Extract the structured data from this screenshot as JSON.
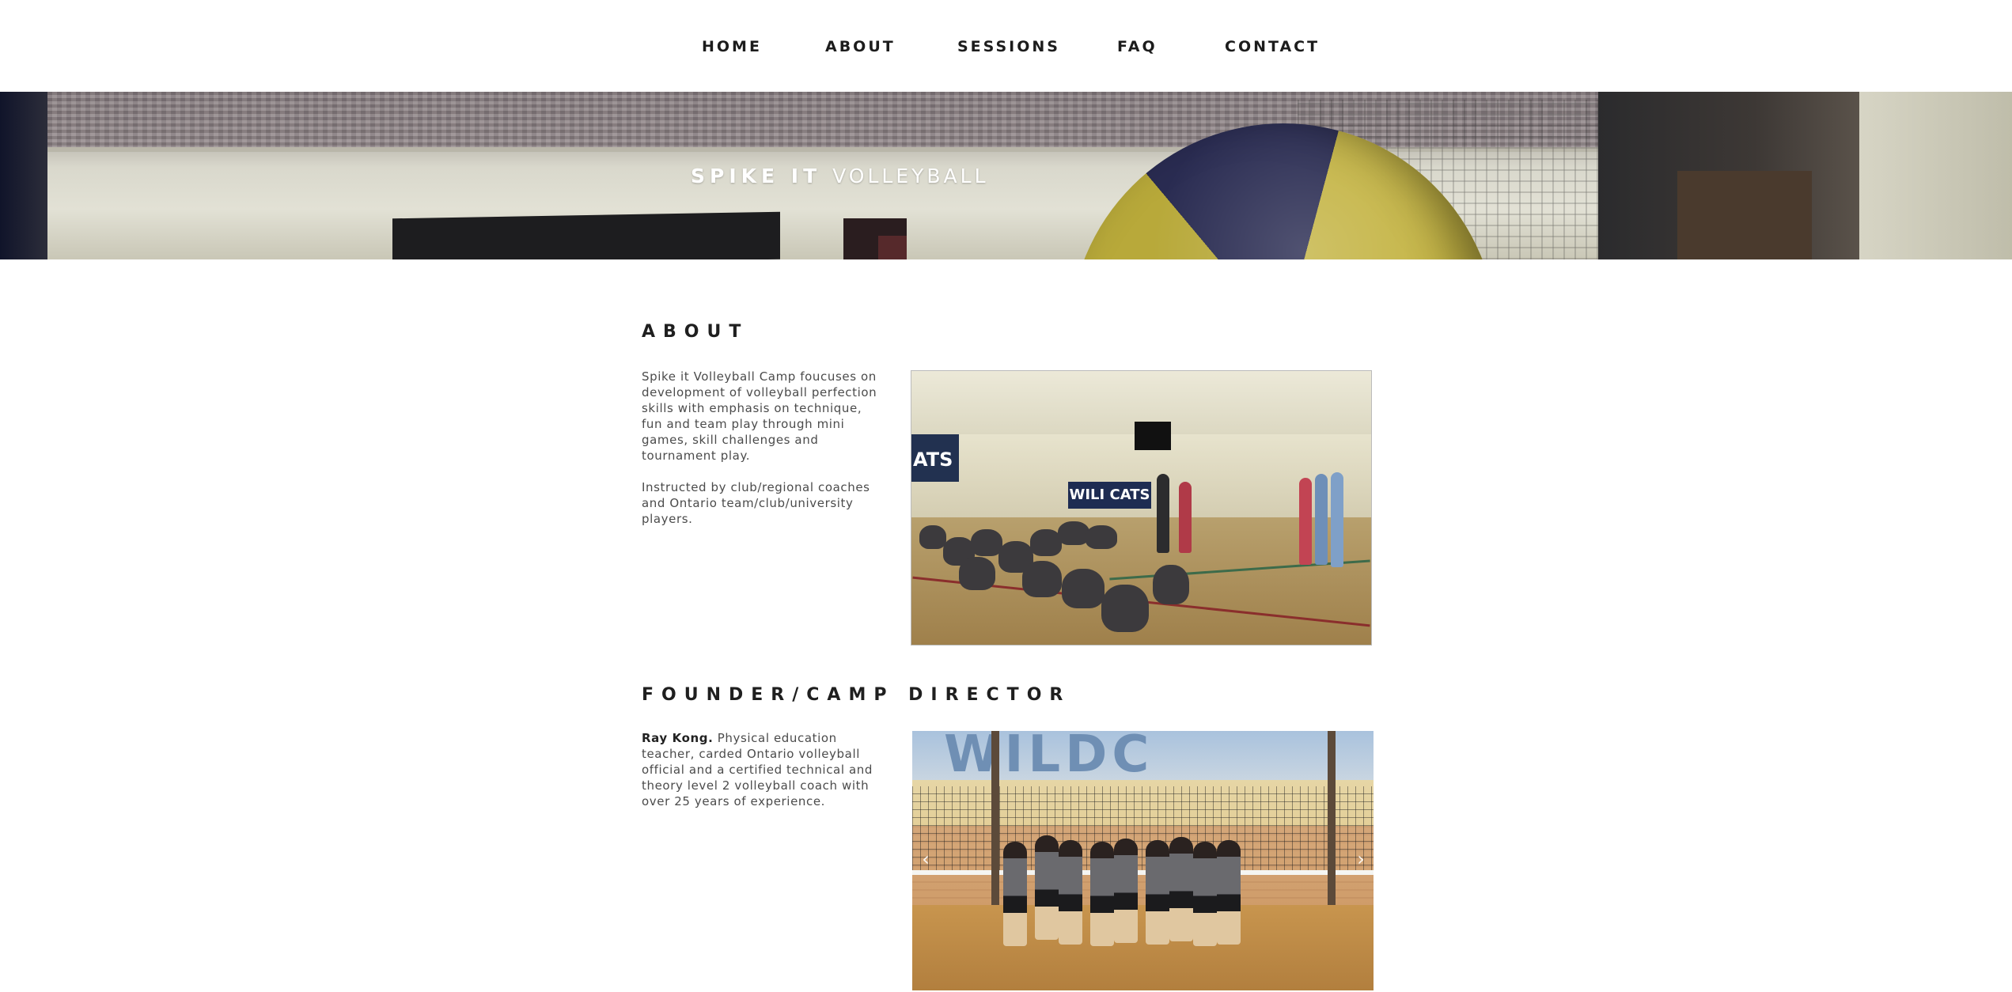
{
  "nav": {
    "items": [
      {
        "label": "HOME"
      },
      {
        "label": "ABOUT"
      },
      {
        "label": "SESSIONS"
      },
      {
        "label": "FAQ"
      },
      {
        "label": "CONTACT"
      }
    ]
  },
  "hero": {
    "brand_bold": "SPIKE IT",
    "brand_light": "VOLLEYBALL"
  },
  "about": {
    "heading": "ABOUT",
    "paragraph1": "Spike it Volleyball Camp foucuses on development of volleyball perfection skills with emphasis on technique, fun and team play through mini games, skill challenges and tournament play.",
    "paragraph2": "Instructed by club/regional coaches and Ontario team/club/university players."
  },
  "founder": {
    "heading": "FOUNDER/CAMP DIRECTOR",
    "name": "Ray Kong.",
    "bio": "Physical education teacher, carded Ontario volleyball official and a certified technical and theory level 2 volleyball coach with over 25 years of experience."
  },
  "photo1": {
    "banner_text": "WILI CATS",
    "wall_text": "ATS"
  },
  "photo2": {
    "wall_text": "WILDC"
  },
  "slider": {
    "prev_icon": "chevron-left-icon",
    "next_icon": "chevron-right-icon",
    "prev_glyph": "‹",
    "next_glyph": "›"
  }
}
